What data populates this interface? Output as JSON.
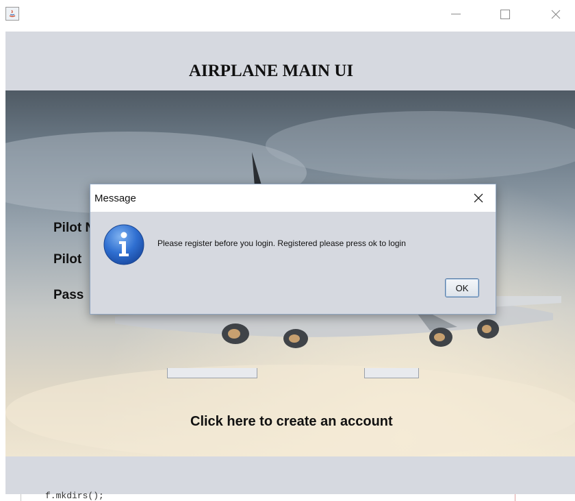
{
  "window": {
    "minimize_glyph": "—",
    "close_glyph": "✕"
  },
  "header": {
    "title": "AIRPLANE MAIN UI"
  },
  "form": {
    "pilot_name_label": "Pilot Name :",
    "pilot_label_partial": "Pilot",
    "password_label_partial": "Pass",
    "pilot_name_value": ""
  },
  "links": {
    "create_account": "Click here to create an account"
  },
  "dialog": {
    "title": "Message",
    "message": "Please register before you login. Registered please press ok to login",
    "ok_label": "OK",
    "icon": "info-icon",
    "close_glyph": "✕"
  },
  "code_snippet": "f.mkdirs();",
  "colors": {
    "panel": "#d6d9e0",
    "dialog_border": "#8ea4c0",
    "info_blue": "#2f6fd1"
  }
}
